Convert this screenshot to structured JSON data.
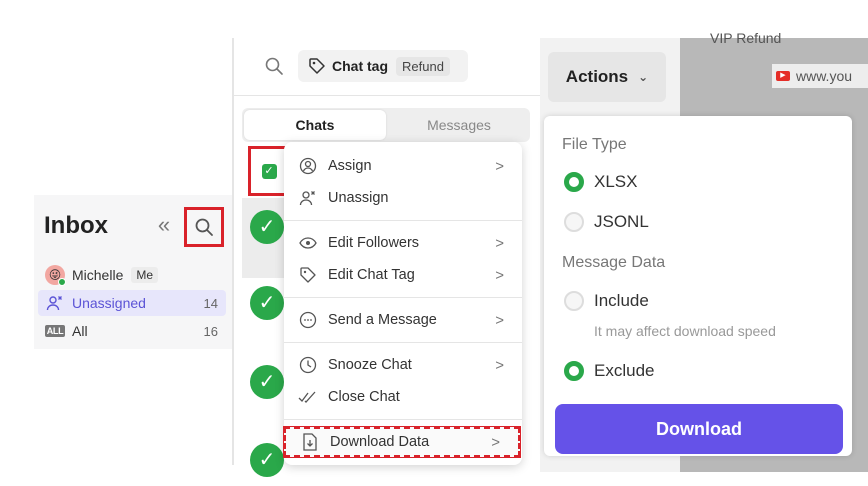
{
  "inbox": {
    "title": "Inbox",
    "items": [
      {
        "label": "Michelle",
        "badge": "Me",
        "count": ""
      },
      {
        "label": "Unassigned",
        "count": "14"
      },
      {
        "label": "All",
        "count": "16",
        "icon_text": "ALL"
      }
    ]
  },
  "chat_panel": {
    "tag_label": "Chat tag",
    "tag_value": "Refund",
    "tabs": [
      "Chats",
      "Messages"
    ]
  },
  "menu": {
    "items": [
      {
        "label": "Assign"
      },
      {
        "label": "Unassign"
      },
      {
        "label": "Edit Followers"
      },
      {
        "label": "Edit Chat Tag"
      },
      {
        "label": "Send a Message"
      },
      {
        "label": "Snooze Chat"
      },
      {
        "label": "Close Chat"
      },
      {
        "label": "Download Data"
      }
    ]
  },
  "actions": {
    "button_label": "Actions",
    "bg_text_1": "VIP   Refund",
    "bg_text_2": "www.you",
    "file_type_title": "File Type",
    "file_types": [
      "XLSX",
      "JSONL"
    ],
    "message_data_title": "Message Data",
    "include_label": "Include",
    "include_hint": "It may affect download speed",
    "exclude_label": "Exclude",
    "download_label": "Download"
  },
  "colors": {
    "accent": "#6552e8",
    "green": "#2aa84a",
    "highlight": "#d9222a"
  }
}
